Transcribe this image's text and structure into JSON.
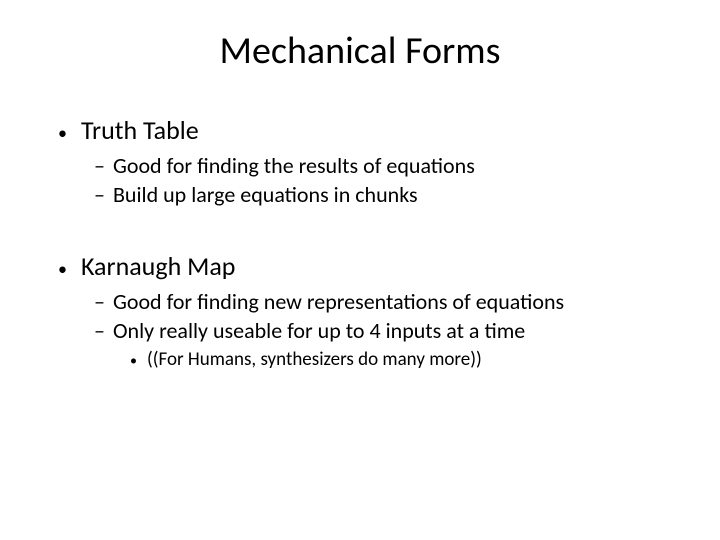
{
  "title": "Mechanical Forms",
  "sections": [
    {
      "heading": "Truth Table",
      "points": [
        "Good for finding the results of equations",
        "Build up large equations in chunks"
      ],
      "subnote": null
    },
    {
      "heading": "Karnaugh Map",
      "points": [
        "Good for finding new representations of equations",
        "Only really useable for up to 4 inputs at a time"
      ],
      "subnote": "((For Humans, synthesizers do many more))"
    }
  ]
}
